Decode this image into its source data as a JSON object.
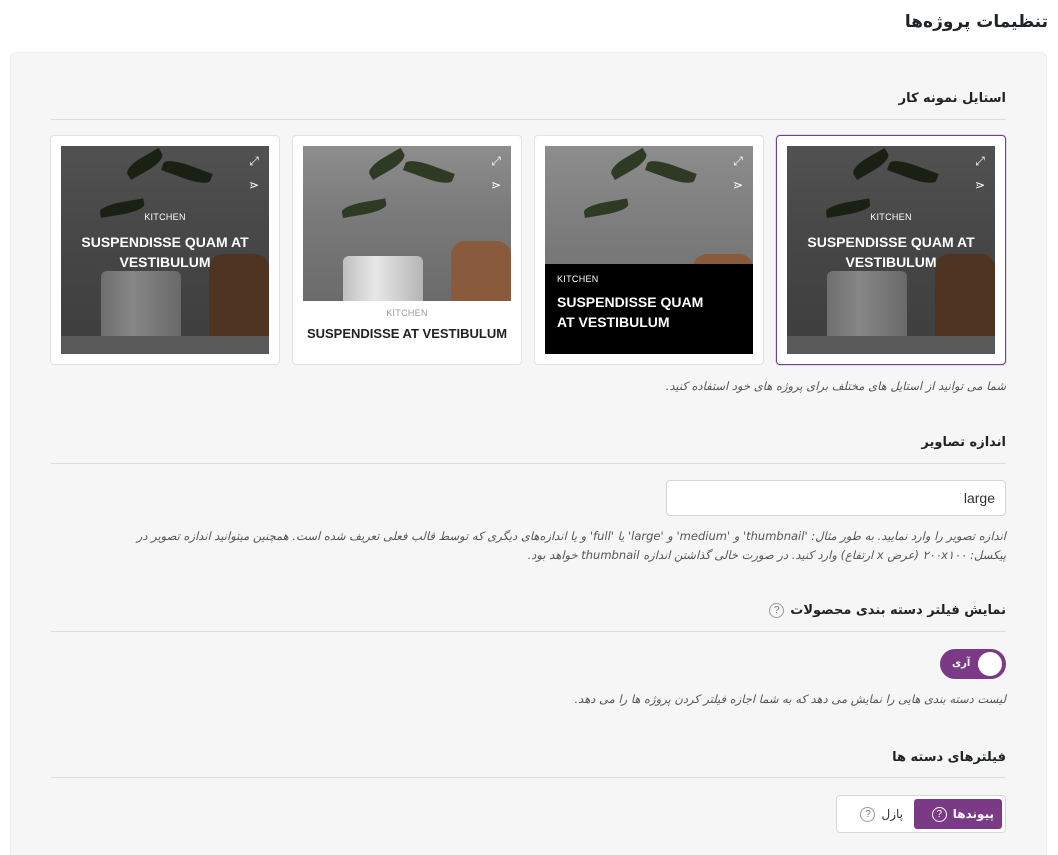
{
  "page": {
    "title": "تنظیمات پروژه‌ها"
  },
  "style_section": {
    "title": "استایل نمونه کار",
    "description": "شما می توانید از استایل های مختلف برای پروژه های خود استفاده کنید.",
    "cards": [
      {
        "category": "KITCHEN",
        "title": "SUSPENDISSE QUAM AT VESTIBULUM",
        "selected": true
      },
      {
        "category": "KITCHEN",
        "title": "SUSPENDISSE QUAM AT VESTIBULUM",
        "selected": false
      },
      {
        "category": "KITCHEN",
        "title": "SUSPENDISSE AT VESTIBULUM",
        "selected": false
      },
      {
        "category": "KITCHEN",
        "title": "SUSPENDISSE QUAM AT VESTIBULUM",
        "selected": false
      }
    ]
  },
  "image_size": {
    "title": "اندازه تصاویر",
    "value": "large",
    "description_line1": "اندازه تصویر را وارد نمایید. به طور مثال: 'thumbnail' و 'medium' و 'large' یا 'full' و یا اندازه‌های دیگری که توسط قالب فعلی تعریف شده است. همچنین میتوانید اندازه تصویر در",
    "description_line2": "پیکسل: ۲۰۰x۱۰۰ (عرض x ارتفاع) وارد کنید. در صورت خالی گذاشتن اندازه thumbnail خواهد بود."
  },
  "filter_section": {
    "title": "نمایش فیلتر دسته بندی محصولات",
    "help": "?",
    "toggle_label": "آری",
    "toggle_on": true,
    "description": "لیست دسته بندی هایی را نمایش می دهد که به شما اجازه فیلتر کردن پروژه ها را می دهد."
  },
  "category_filters": {
    "title": "فیلترهای دسته ها",
    "options": [
      {
        "label": "پیوندها",
        "help": "?",
        "active": true
      },
      {
        "label": "پازل",
        "help": "?",
        "active": false
      }
    ]
  },
  "icons": {
    "expand": "expand-icon",
    "share": "share-icon",
    "help": "help-circle-icon"
  },
  "colors": {
    "accent": "#7b3a85",
    "selected_border": "#6f3e8f"
  }
}
